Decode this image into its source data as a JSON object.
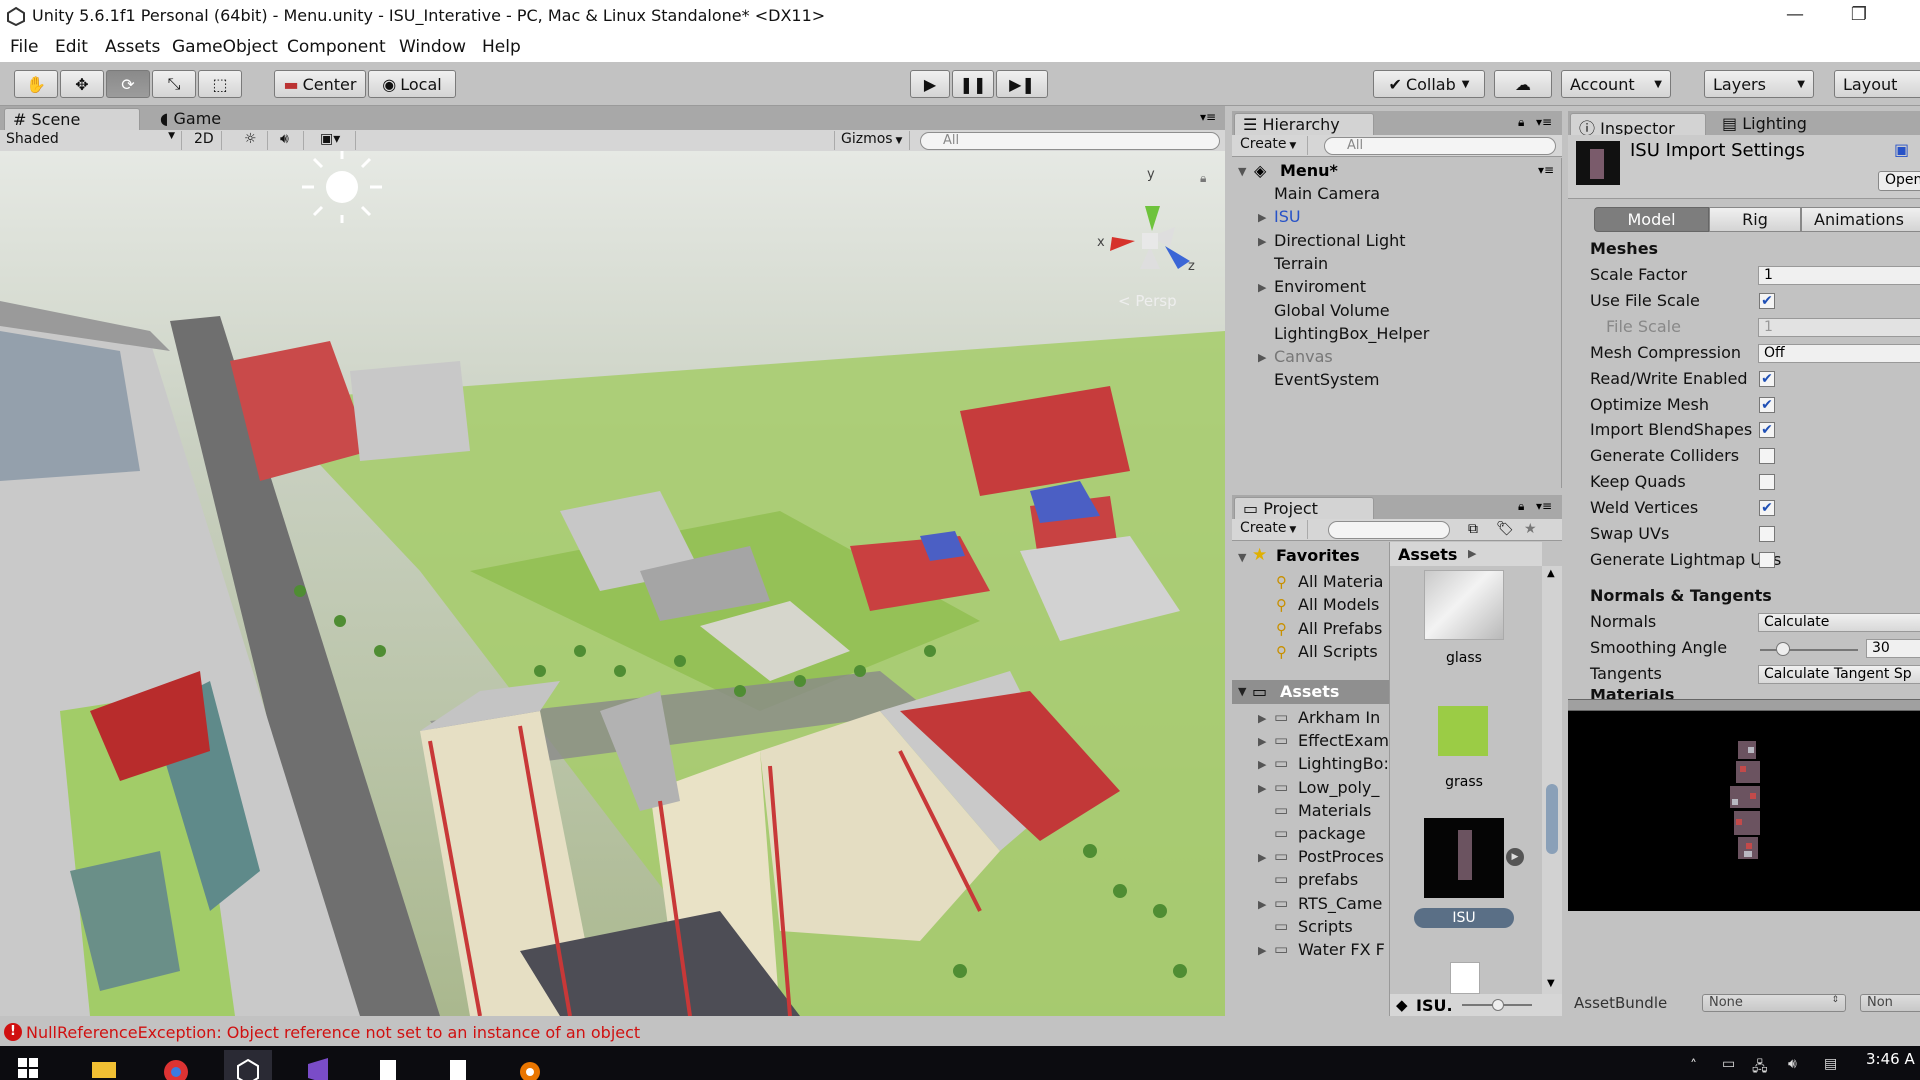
{
  "window": {
    "title": "Unity 5.6.1f1 Personal (64bit) - Menu.unity - ISU_Interative - PC, Mac & Linux Standalone* <DX11>",
    "controls": [
      "—",
      "❐"
    ]
  },
  "menu": [
    "File",
    "Edit",
    "Assets",
    "GameObject",
    "Component",
    "Window",
    "Help"
  ],
  "toolbar": {
    "pivot": "Center",
    "space": "Local",
    "collab": "Collab",
    "account": "Account",
    "layers": "Layers",
    "layout": "Layout"
  },
  "scene_panel": {
    "tabs": [
      "Scene",
      "Game"
    ],
    "shading": "Shaded",
    "mode_2d": "2D",
    "gizmos": "Gizmos",
    "search_placeholder": "All",
    "gizmo_axes": {
      "y": "y",
      "x": "x",
      "z": "z"
    },
    "projection": "Persp"
  },
  "hierarchy": {
    "title": "Hierarchy",
    "create": "Create",
    "search_placeholder": "All",
    "scene_name": "Menu*",
    "items": [
      {
        "label": "Main Camera",
        "expandable": false,
        "style": "normal"
      },
      {
        "label": "ISU",
        "expandable": true,
        "style": "prefab"
      },
      {
        "label": "Directional Light",
        "expandable": true,
        "style": "normal"
      },
      {
        "label": "Terrain",
        "expandable": false,
        "style": "normal"
      },
      {
        "label": "Enviroment",
        "expandable": true,
        "style": "normal"
      },
      {
        "label": "Global Volume",
        "expandable": false,
        "style": "normal"
      },
      {
        "label": "LightingBox_Helper",
        "expandable": false,
        "style": "normal"
      },
      {
        "label": "Canvas",
        "expandable": true,
        "style": "disabled"
      },
      {
        "label": "EventSystem",
        "expandable": false,
        "style": "normal"
      }
    ]
  },
  "project": {
    "title": "Project",
    "create": "Create",
    "favorites_label": "Favorites",
    "favorites": [
      "All Materia",
      "All Models",
      "All Prefabs",
      "All Scripts"
    ],
    "assets_label": "Assets",
    "folders": [
      {
        "label": "Arkham In",
        "expandable": true
      },
      {
        "label": "EffectExam",
        "expandable": true
      },
      {
        "label": "LightingBo:",
        "expandable": true
      },
      {
        "label": "Low_poly_",
        "expandable": true
      },
      {
        "label": "Materials",
        "expandable": false
      },
      {
        "label": "package",
        "expandable": false
      },
      {
        "label": "PostProces",
        "expandable": true
      },
      {
        "label": "prefabs",
        "expandable": false
      },
      {
        "label": "RTS_Came",
        "expandable": true
      },
      {
        "label": "Scripts",
        "expandable": false
      },
      {
        "label": "Water FX F",
        "expandable": true
      }
    ],
    "grid_header": "Assets",
    "assets": [
      {
        "label": "glass",
        "kind": "texture"
      },
      {
        "label": "grass",
        "kind": "color",
        "color": "#9bcc45"
      },
      {
        "label": "ISU",
        "kind": "model",
        "selected": true
      }
    ],
    "footer": "ISU."
  },
  "inspector": {
    "tabs": [
      "Inspector",
      "Lighting"
    ],
    "header_title": "ISU Import Settings",
    "open_button": "Open",
    "subtabs": [
      "Model",
      "Rig",
      "Animations"
    ],
    "meshes_header": "Meshes",
    "meshes": [
      {
        "label": "Scale Factor",
        "type": "field",
        "value": "1"
      },
      {
        "label": "Use File Scale",
        "type": "check",
        "checked": true
      },
      {
        "label": "File Scale",
        "type": "field",
        "value": "1",
        "disabled": true
      },
      {
        "label": "Mesh Compression",
        "type": "field",
        "value": "Off"
      },
      {
        "label": "Read/Write Enabled",
        "type": "check",
        "checked": true
      },
      {
        "label": "Optimize Mesh",
        "type": "check",
        "checked": true
      },
      {
        "label": "Import BlendShapes",
        "type": "check",
        "checked": true
      },
      {
        "label": "Generate Colliders",
        "type": "check",
        "checked": false
      },
      {
        "label": "Keep Quads",
        "type": "check",
        "checked": false
      },
      {
        "label": "Weld Vertices",
        "type": "check",
        "checked": true
      },
      {
        "label": "Swap UVs",
        "type": "check",
        "checked": false
      },
      {
        "label": "Generate Lightmap UVs",
        "type": "check",
        "checked": false
      }
    ],
    "normals_header": "Normals & Tangents",
    "normals": {
      "label": "Normals",
      "value": "Calculate"
    },
    "smoothing": {
      "label": "Smoothing Angle",
      "value": "30"
    },
    "tangents": {
      "label": "Tangents",
      "value": "Calculate Tangent Sp"
    },
    "materials_header": "Materials",
    "assetbundle_label": "AssetBundle",
    "assetbundle_value": "None",
    "assetbundle_variant": "Non"
  },
  "status": {
    "error": "NullReferenceException: Object reference not set to an instance of an object"
  },
  "taskbar": {
    "clock": "3:46 A"
  },
  "colors": {
    "editor_bg": "#c2c2c2",
    "prefab_blue": "#2752c7",
    "error_red": "#d01010",
    "grass": "#9bcc45",
    "building_red": "#c83838"
  }
}
